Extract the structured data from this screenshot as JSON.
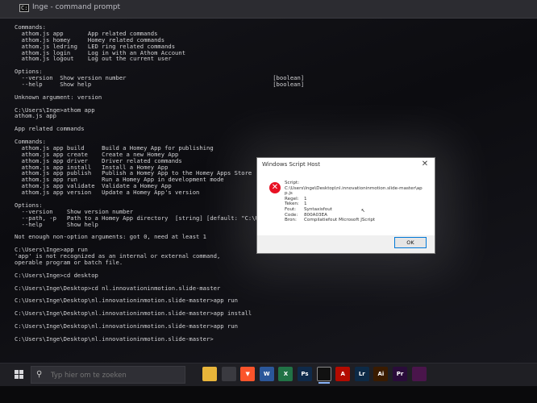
{
  "window": {
    "title": "Inge - command prompt"
  },
  "console_lines": [
    "Commands:",
    "  athom.js app       App related commands",
    "  athom.js homey     Homey related commands",
    "  athom.js ledring   LED ring related commands",
    "  athom.js login     Log in with an Athom Account",
    "  athom.js logout    Log out the current user",
    "",
    "Options:",
    "  --version  Show version number                                          [boolean]",
    "  --help     Show help                                                    [boolean]",
    "",
    "Unknown argument: version",
    "",
    "C:\\Users\\Inge>athom app",
    "athom.js app",
    "",
    "App related commands",
    "",
    "Commands:",
    "  athom.js app build     Build a Homey App for publishing",
    "  athom.js app create    Create a new Homey App",
    "  athom.js app driver    Driver related commands",
    "  athom.js app install   Install a Homey App",
    "  athom.js app publish   Publish a Homey App to the Homey Apps Store",
    "  athom.js app run       Run a Homey App in development mode",
    "  athom.js app validate  Validate a Homey App",
    "  athom.js app version   Update a Homey App's version",
    "",
    "Options:",
    "  --version    Show version number                                      [boolean]",
    "  --path, -p   Path to a Homey App directory  [string] [default: \"C:\\Users\\Inge\"]",
    "  --help       Show help                                                [boolean]",
    "",
    "Not enough non-option arguments: got 0, need at least 1",
    "",
    "C:\\Users\\Inge>app run",
    "'app' is not recognized as an internal or external command,",
    "operable program or batch file.",
    "",
    "C:\\Users\\Inge>cd desktop",
    "",
    "C:\\Users\\Inge\\Desktop>cd nl.innovationinmotion.slide-master",
    "",
    "C:\\Users\\Inge\\Desktop\\nl.innovationinmotion.slide-master>app run",
    "",
    "C:\\Users\\Inge\\Desktop\\nl.innovationinmotion.slide-master>app install",
    "",
    "C:\\Users\\Inge\\Desktop\\nl.innovationinmotion.slide-master>app run",
    "",
    "C:\\Users\\Inge\\Desktop\\nl.innovationinmotion.slide-master>"
  ],
  "dialog": {
    "title": "Windows Script Host",
    "close_glyph": "✕",
    "icon": "error-icon",
    "icon_glyph": "✕",
    "rows": [
      {
        "label": "Script:",
        "value": ""
      },
      {
        "label": "",
        "value": "C:\\Users\\Inge\\Desktop\\nl.innovationinmotion.slide-master\\ap"
      },
      {
        "label": "",
        "value": "p.js"
      },
      {
        "label": "Regel:",
        "value": "1"
      },
      {
        "label": "Teken:",
        "value": "1"
      },
      {
        "label": "Fout:",
        "value": "Syntaxisfout"
      },
      {
        "label": "Code:",
        "value": "800A03EA"
      },
      {
        "label": "Bron:",
        "value": "Compilatiefout Microsoft JScript"
      }
    ],
    "ok_label": "OK"
  },
  "taskbar": {
    "search_placeholder": "Typ hier om te zoeken",
    "search_icon": "search-icon",
    "icons": [
      {
        "name": "file-explorer-icon",
        "glyph": "",
        "color": "#e8b53a"
      },
      {
        "name": "store-icon",
        "glyph": "",
        "color": "#3a3a40"
      },
      {
        "name": "brave-browser-icon",
        "glyph": "▼",
        "color": "#fb542b"
      },
      {
        "name": "word-icon",
        "glyph": "W",
        "color": "#2b579a"
      },
      {
        "name": "excel-icon",
        "glyph": "X",
        "color": "#217346"
      },
      {
        "name": "photoshop-icon",
        "glyph": "Ps",
        "color": "#0f2a4a"
      },
      {
        "name": "command-prompt-icon",
        "glyph": "",
        "color": "#111111"
      },
      {
        "name": "acrobat-icon",
        "glyph": "A",
        "color": "#b30b00"
      },
      {
        "name": "lightroom-icon",
        "glyph": "Lr",
        "color": "#0d2a46"
      },
      {
        "name": "illustrator-icon",
        "glyph": "Ai",
        "color": "#3a1b00"
      },
      {
        "name": "premiere-icon",
        "glyph": "Pr",
        "color": "#2a0c3a"
      },
      {
        "name": "slack-icon",
        "glyph": "",
        "color": "#4a154b"
      }
    ]
  }
}
